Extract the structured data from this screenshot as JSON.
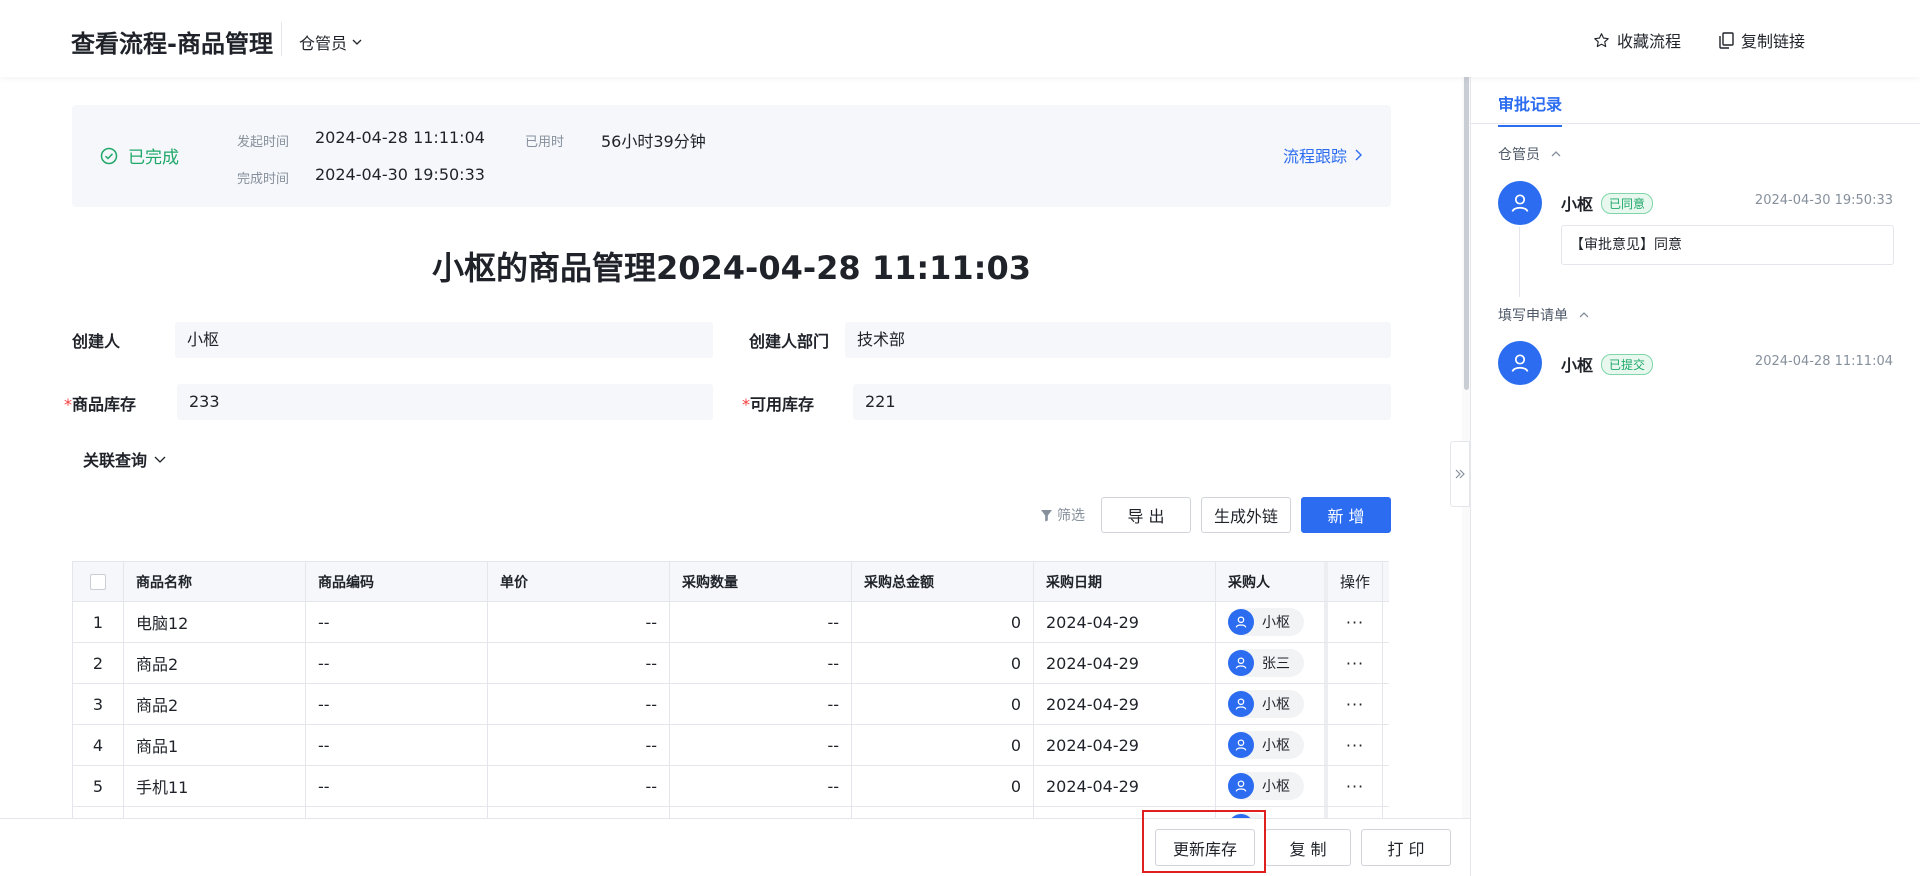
{
  "header": {
    "title": "查看流程-商品管理",
    "role": "仓管员",
    "favorite": "收藏流程",
    "copy_link": "复制链接"
  },
  "status": {
    "state": "已完成",
    "start_label": "发起时间",
    "start_value": "2024-04-28 11:11:04",
    "used_label": "已用时",
    "used_value": "56小时39分钟",
    "end_label": "完成时间",
    "end_value": "2024-04-30 19:50:33",
    "track": "流程跟踪"
  },
  "document": {
    "title": "小枢的商品管理2024-04-28 11:11:03"
  },
  "form": {
    "creator_label": "创建人",
    "creator_value": "小枢",
    "dept_label": "创建人部门",
    "dept_value": "技术部",
    "stock_label": "商品库存",
    "stock_value": "233",
    "available_label": "可用库存",
    "available_value": "221",
    "related": "关联查询"
  },
  "toolbar": {
    "filter": "筛选",
    "export": "导 出",
    "external_link": "生成外链",
    "add": "新 增"
  },
  "table": {
    "columns": [
      "商品名称",
      "商品编码",
      "单价",
      "采购数量",
      "采购总金额",
      "采购日期",
      "采购人",
      "操作"
    ],
    "rows": [
      {
        "idx": "1",
        "name": "电脑12",
        "code": "--",
        "price": "--",
        "qty": "--",
        "total": "0",
        "date": "2024-04-29",
        "buyer": "小枢",
        "op": "···"
      },
      {
        "idx": "2",
        "name": "商品2",
        "code": "--",
        "price": "--",
        "qty": "--",
        "total": "0",
        "date": "2024-04-29",
        "buyer": "张三",
        "op": "···"
      },
      {
        "idx": "3",
        "name": "商品2",
        "code": "--",
        "price": "--",
        "qty": "--",
        "total": "0",
        "date": "2024-04-29",
        "buyer": "小枢",
        "op": "···"
      },
      {
        "idx": "4",
        "name": "商品1",
        "code": "--",
        "price": "--",
        "qty": "--",
        "total": "0",
        "date": "2024-04-29",
        "buyer": "小枢",
        "op": "···"
      },
      {
        "idx": "5",
        "name": "手机11",
        "code": "--",
        "price": "--",
        "qty": "--",
        "total": "0",
        "date": "2024-04-29",
        "buyer": "小枢",
        "op": "···"
      }
    ]
  },
  "bottom": {
    "update_stock": "更新库存",
    "copy": "复 制",
    "print": "打 印"
  },
  "approval": {
    "tab": "审批记录",
    "groups": [
      {
        "title": "仓管员",
        "name": "小枢",
        "tag": "已同意",
        "time": "2024-04-30 19:50:33",
        "opinion": "【审批意见】同意"
      },
      {
        "title": "填写申请单",
        "name": "小枢",
        "tag": "已提交",
        "time": "2024-04-28 11:11:04"
      }
    ]
  },
  "colors": {
    "primary": "#2b6cf0",
    "success": "#1fa86a",
    "required": "#f53f3f",
    "highlight": "#e02020"
  },
  "icons": [
    "star-icon",
    "copy-icon",
    "chevron-down-icon",
    "check-circle-icon",
    "chevron-right-icon",
    "filter-icon",
    "user-icon",
    "chevron-up-icon",
    "double-chevron-right-icon"
  ]
}
